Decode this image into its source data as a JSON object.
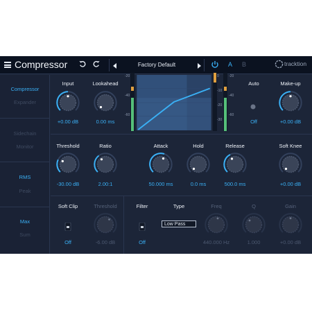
{
  "header": {
    "menu_icon": "hamburger-icon",
    "title": "Compressor",
    "undo_icon": "undo-icon",
    "redo_icon": "redo-icon",
    "prev_preset_icon": "triangle-left-icon",
    "preset_name": "Factory Default",
    "next_preset_icon": "triangle-right-icon",
    "power_icon": "power-icon",
    "ab_a": "A",
    "ab_b": "B",
    "logo_text": "tracktion"
  },
  "sidebar": {
    "mode": {
      "active": "Compressor",
      "inactive": "Expander"
    },
    "detect": {
      "active": "Sidechain",
      "inactive": "Monitor"
    },
    "level": {
      "active": "RMS",
      "inactive": "Peak"
    },
    "link": {
      "active": "Max",
      "inactive": "Sum"
    }
  },
  "top_section": {
    "input": {
      "label": "Input",
      "value": "+0.00 dB"
    },
    "lookahead": {
      "label": "Lookahead",
      "value": "0.00 ms"
    },
    "auto": {
      "label": "Auto",
      "value": "Off"
    },
    "makeup": {
      "label": "Make-up",
      "value": "+0.00 dB"
    },
    "meter_scale_left": [
      "-20",
      "-40",
      "-60"
    ],
    "meter_scale_right": [
      "0",
      "-10",
      "-20",
      "-30"
    ],
    "meter_scale_far": [
      "-20",
      "-40",
      "-60"
    ]
  },
  "mid_section": {
    "threshold": {
      "label": "Threshold",
      "value": "-30.00 dB"
    },
    "ratio": {
      "label": "Ratio",
      "value": "2.00:1"
    },
    "attack": {
      "label": "Attack",
      "value": "50.000 ms"
    },
    "hold": {
      "label": "Hold",
      "value": "0.0 ms"
    },
    "release": {
      "label": "Release",
      "value": "500.0 ms"
    },
    "soft_knee": {
      "label": "Soft Knee",
      "value": "+0.00 dB"
    }
  },
  "bottom_section": {
    "soft_clip": {
      "label": "Soft Clip",
      "value": "Off"
    },
    "clip_threshold": {
      "label": "Threshold",
      "value": "-6.00 dB"
    },
    "filter": {
      "label": "Filter",
      "value": "Off"
    },
    "type": {
      "label": "Type",
      "value": "Low Pass"
    },
    "freq": {
      "label": "Freq",
      "value": "440.000 Hz"
    },
    "q": {
      "label": "Q",
      "value": "1.000"
    },
    "gain": {
      "label": "Gain",
      "value": "+0.00 dB"
    }
  },
  "colors": {
    "accent": "#3ab0f5",
    "background": "#1c2538",
    "topbar": "#0b1220",
    "meter_green": "#55c07a",
    "meter_amber": "#e0a040"
  }
}
